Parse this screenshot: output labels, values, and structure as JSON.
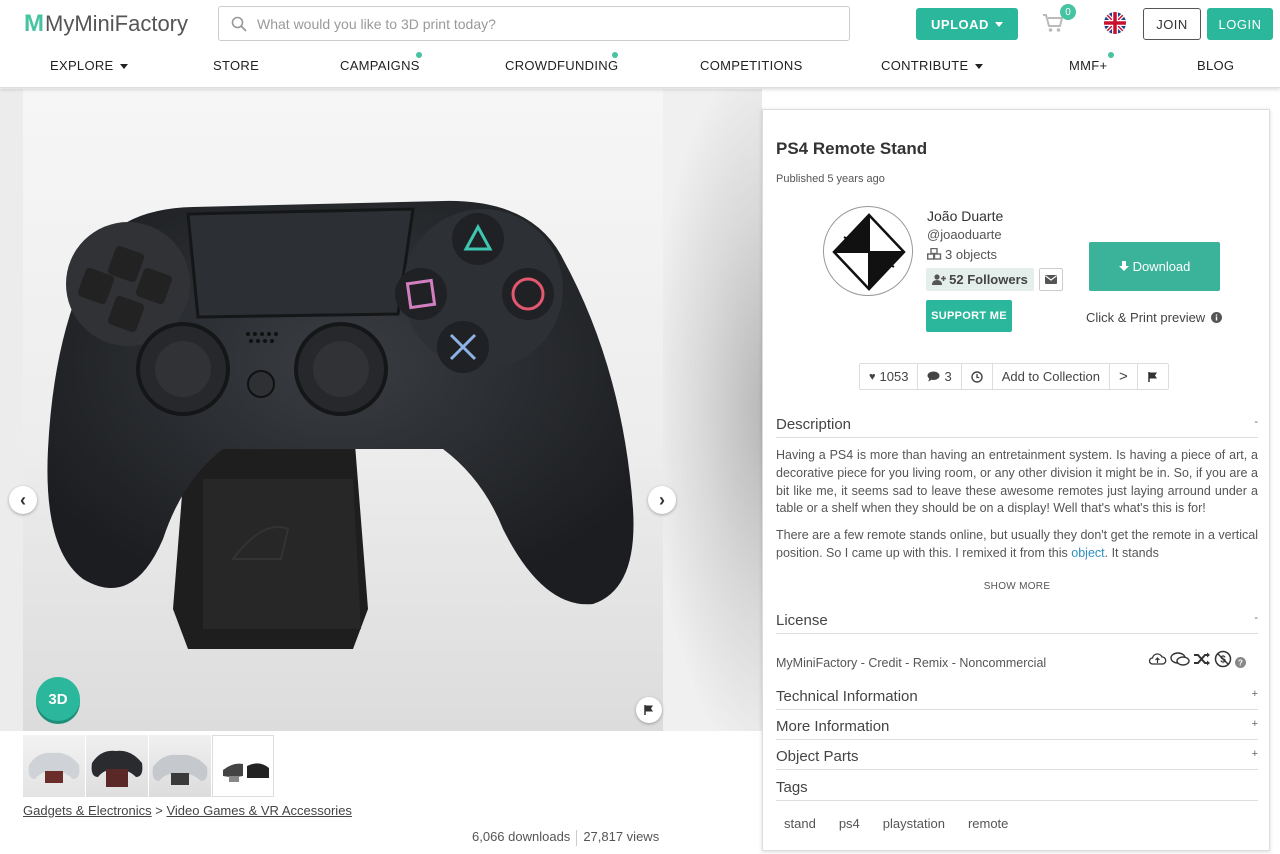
{
  "header": {
    "logo_m": "M",
    "logo_text": "MyMiniFactory",
    "search_placeholder": "What would you like to 3D print today?",
    "upload_label": "UPLOAD",
    "cart_count": "0",
    "join_label": "JOIN",
    "login_label": "LOGIN"
  },
  "nav": {
    "explore": "EXPLORE",
    "store": "STORE",
    "campaigns": "CAMPAIGNS",
    "crowdfunding": "CROWDFUNDING",
    "competitions": "COMPETITIONS",
    "contribute": "CONTRIBUTE",
    "mmf_plus": "MMF+",
    "blog": "BLOG"
  },
  "gallery": {
    "btn_3d": "3D",
    "breadcrumb": {
      "cat1": "Gadgets & Electronics",
      "sep": ">",
      "cat2": "Video Games & VR Accessories"
    },
    "downloads": "6,066 downloads",
    "views": "27,817 views"
  },
  "object": {
    "title": "PS4 Remote Stand",
    "published": "Published 5 years ago",
    "designer_name": "João Duarte",
    "designer_handle": "@joaoduarte",
    "designer_objects": "3 objects",
    "followers": "52 Followers",
    "support_label": "SUPPORT ME",
    "download_label": "Download",
    "preview_label": "Click & Print preview",
    "likes": "1053",
    "comments": "3",
    "add_collection": "Add to Collection"
  },
  "sections": {
    "description_title": "Description",
    "description_toggle": "-",
    "desc_p1": "Having a PS4 is more than having an entretainment system. Is having a piece of art, a decorative piece for you living room, or any other division it might be in. So, if you are a bit like me, it seems sad to leave these awesome remotes just laying arround under a table or a shelf when they should be on a display! Well that's what's this is for!",
    "desc_p2_a": "There are a few remote stands online, but usually they don't get the remote in a vertical position. So I came up with this. I remixed it from this ",
    "desc_p2_link": "object",
    "desc_p2_b": ". It stands",
    "show_more": "SHOW MORE",
    "license_title": "License",
    "license_toggle": "-",
    "license_text": "MyMiniFactory - Credit - Remix - Noncommercial",
    "tech_title": "Technical Information",
    "tech_toggle": "+",
    "more_title": "More Information",
    "more_toggle": "+",
    "parts_title": "Object Parts",
    "parts_toggle": "+",
    "tags_title": "Tags",
    "tags": [
      "stand",
      "ps4",
      "playstation",
      "remote"
    ]
  },
  "colors": {
    "accent": "#2bb79b",
    "link": "#2b8fc4"
  }
}
